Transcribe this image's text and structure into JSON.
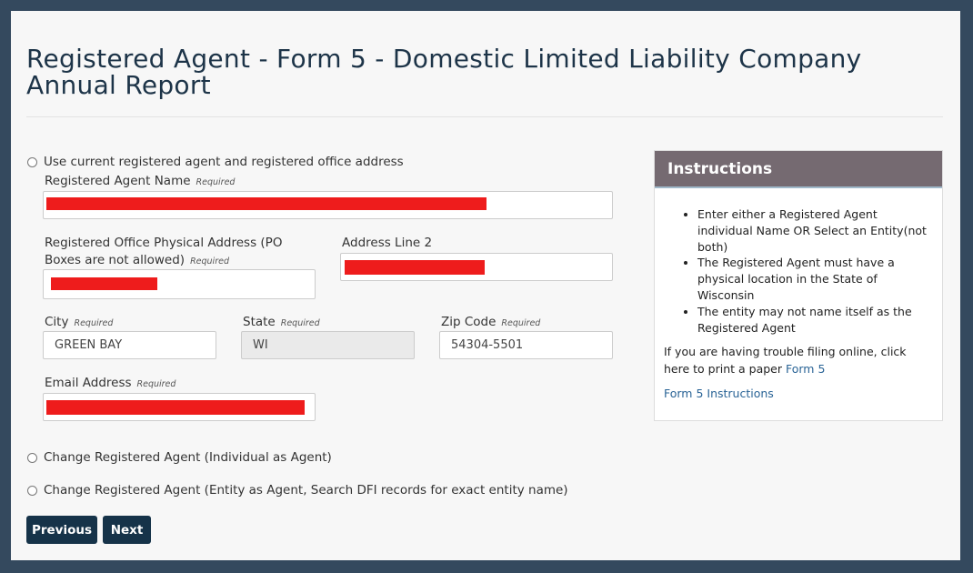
{
  "page_title": "Registered Agent - Form 5 - Domestic Limited Liability Company Annual Report",
  "options": {
    "use_current": "Use current registered agent and registered office address",
    "change_individual": "Change Registered Agent (Individual as Agent)",
    "change_entity": "Change Registered Agent (Entity as Agent, Search DFI records for exact entity name)"
  },
  "required": "Required",
  "fields": {
    "agent_name_label": "Registered Agent Name",
    "office_address_label": "Registered Office Physical Address (PO Boxes are not allowed)",
    "address_line2_label": "Address Line 2",
    "city_label": "City",
    "city_value": "GREEN BAY",
    "state_label": "State",
    "state_value": "WI",
    "zip_label": "Zip Code",
    "zip_value": "54304-5501",
    "email_label": "Email Address"
  },
  "buttons": {
    "previous": "Previous",
    "next": "Next"
  },
  "instructions": {
    "title": "Instructions",
    "items": [
      "Enter either a Registered Agent individual Name OR Select an Entity(not both)",
      "The Registered Agent must have a physical location in the State of Wisconsin",
      "The entity may not name itself as the Registered Agent"
    ],
    "trouble_text": "If you are having trouble filing online, click here to print a paper",
    "form_link": "Form 5",
    "instructions_link": "Form 5 Instructions"
  },
  "colors": {
    "frame": "#34495e",
    "button": "#163349",
    "instructions_header": "#756a71",
    "redaction": "#ee1c1c"
  }
}
